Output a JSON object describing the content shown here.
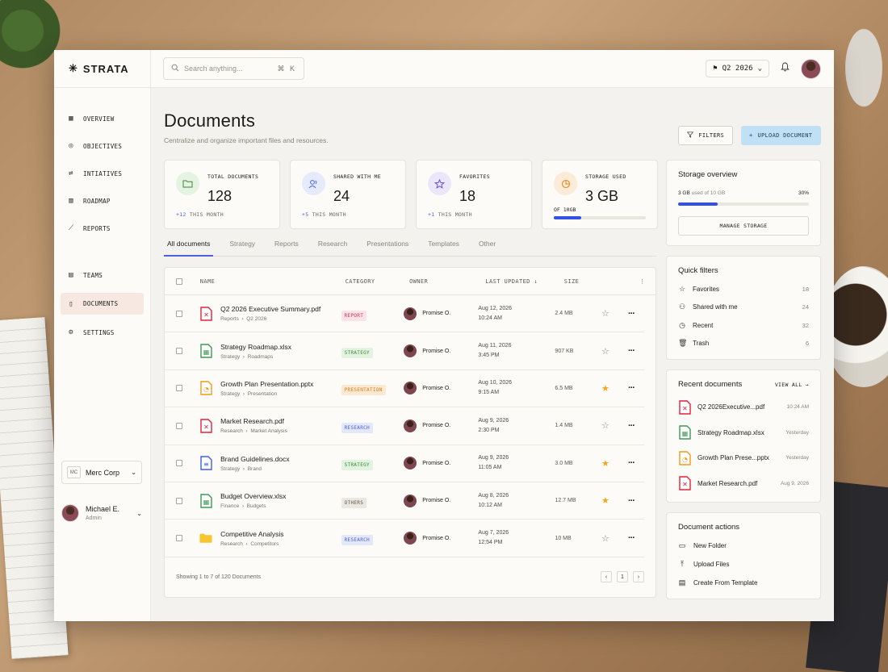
{
  "brand": {
    "name": "STRATA"
  },
  "search": {
    "placeholder": "Search anything...",
    "shortcut": "⌘ K"
  },
  "header": {
    "period": "Q2 2026"
  },
  "sidebar": {
    "items": [
      {
        "label": "OVERVIEW",
        "icon": "grid-icon"
      },
      {
        "label": "OBJECTIVES",
        "icon": "target-icon"
      },
      {
        "label": "INTIATIVES",
        "icon": "arrows-icon"
      },
      {
        "label": "ROADMAP",
        "icon": "map-icon"
      },
      {
        "label": "REPORTS",
        "icon": "chart-icon"
      }
    ],
    "items2": [
      {
        "label": "TEAMS",
        "icon": "team-icon"
      },
      {
        "label": "DOCUMENTS",
        "icon": "document-icon",
        "active": true
      },
      {
        "label": "SETTINGS",
        "icon": "gear-icon"
      }
    ],
    "org": {
      "initials": "MC",
      "name": "Merc Corp"
    },
    "user": {
      "name": "Michael E.",
      "role": "Admin"
    }
  },
  "page": {
    "title": "Documents",
    "subtitle": "Centralize and organize important files and resources.",
    "filters_label": "FILTERS",
    "upload_label": "UPLOAD DOCUMENT"
  },
  "stats": [
    {
      "label": "TOTAL DOCUMENTS",
      "value": "128",
      "delta": "+12",
      "delta_text": "THIS MONTH",
      "color": "#e4f3e2",
      "icon_color": "#3e8a3a"
    },
    {
      "label": "SHARED WITH ME",
      "value": "24",
      "delta": "+5",
      "delta_text": "THIS MONTH",
      "color": "#e6ebfb",
      "icon_color": "#4a62e0"
    },
    {
      "label": "FAVORITES",
      "value": "18",
      "delta": "+1",
      "delta_text": "THIS MONTH",
      "color": "#ece6fb",
      "icon_color": "#6a4fd8"
    },
    {
      "label": "STORAGE USED",
      "value": "3 GB",
      "of": "OF 10GB",
      "fraction": 0.3,
      "color": "#fcebd8",
      "icon_color": "#e58a1f"
    }
  ],
  "tabs": [
    "All documents",
    "Strategy",
    "Reports",
    "Research",
    "Presentations",
    "Templates",
    "Other"
  ],
  "table": {
    "headers": {
      "name": "NAME",
      "category": "CATEGORY",
      "owner": "OWNER",
      "updated": "LAST UPDATED ↓",
      "size": "SIZE"
    },
    "rows": [
      {
        "name": "Q2 2026 Executive Summary.pdf",
        "path1": "Reports",
        "path2": "Q2 2026",
        "type": "pdf",
        "category": "REPORT",
        "owner": "Promise O.",
        "date": "Aug 12, 2026",
        "time": "10:24 AM",
        "size": "2.4 MB",
        "fav": false
      },
      {
        "name": "Strategy Roadmap.xlsx",
        "path1": "Strategy",
        "path2": "Roadmaps",
        "type": "xlsx",
        "category": "STRATEGY",
        "owner": "Promise O.",
        "date": "Aug 11, 2026",
        "time": "3:45 PM",
        "size": "907 KB",
        "fav": false
      },
      {
        "name": "Growth Plan Presentation.pptx",
        "path1": "Strategy",
        "path2": "Presentation",
        "type": "pptx",
        "category": "PRESENTATION",
        "owner": "Promise O.",
        "date": "Aug 10, 2026",
        "time": "9:15 AM",
        "size": "6.5 MB",
        "fav": true
      },
      {
        "name": "Market Research.pdf",
        "path1": "Research",
        "path2": "Market Analysis",
        "type": "pdf",
        "category": "RESEARCH",
        "owner": "Promise O.",
        "date": "Aug 9, 2026",
        "time": "2:30 PM",
        "size": "1.4 MB",
        "fav": false
      },
      {
        "name": "Brand Guidelines.docx",
        "path1": "Strategy",
        "path2": "Brand",
        "type": "docx",
        "category": "STRATEGY",
        "owner": "Promise O.",
        "date": "Aug 9, 2026",
        "time": "11:05 AM",
        "size": "3.0 MB",
        "fav": true
      },
      {
        "name": "Budget Overview.xlsx",
        "path1": "Finance",
        "path2": "Budgets",
        "type": "xlsx",
        "category": "OTHERS",
        "owner": "Promise O.",
        "date": "Aug 8, 2026",
        "time": "10:12 AM",
        "size": "12.7 MB",
        "fav": true
      },
      {
        "name": "Competitive Analysis",
        "path1": "Research",
        "path2": "Competitors",
        "type": "folder",
        "category": "RESEARCH",
        "owner": "Promise O.",
        "date": "Aug 7, 2026",
        "time": "12:54 PM",
        "size": "10 MB",
        "fav": false
      }
    ],
    "footer": "Showing 1 to 7 of 120 Documents",
    "page": "1"
  },
  "categories": {
    "REPORT": {
      "bg": "#fde3e7",
      "fg": "#d1365a"
    },
    "STRATEGY": {
      "bg": "#e2f3df",
      "fg": "#3d8a3a"
    },
    "PRESENTATION": {
      "bg": "#fde9d2",
      "fg": "#d5801a"
    },
    "RESEARCH": {
      "bg": "#e4e8fb",
      "fg": "#4a62e0"
    },
    "OTHERS": {
      "bg": "#ebe8e3",
      "fg": "#5c574f"
    }
  },
  "storage_panel": {
    "title": "Storage overview",
    "used": "3 GB",
    "of": "used of 10 GB",
    "percent": "30%",
    "fraction": 0.3,
    "button": "MANAGE STORAGE"
  },
  "quick_filters": {
    "title": "Quick filters",
    "items": [
      {
        "label": "Favorites",
        "count": "18",
        "icon": "star-icon"
      },
      {
        "label": "Shared with me",
        "count": "24",
        "icon": "users-icon"
      },
      {
        "label": "Recent",
        "count": "32",
        "icon": "clock-icon"
      },
      {
        "label": "Trash",
        "count": "6",
        "icon": "trash-icon"
      }
    ]
  },
  "recent": {
    "title": "Recent documents",
    "view_all": "VIEW ALL",
    "items": [
      {
        "name": "Q2 2026Executive...pdf",
        "time": "10:24 AM",
        "type": "pdf"
      },
      {
        "name": "Strategy Roadmap.xlsx",
        "time": "Yesterday",
        "type": "xlsx"
      },
      {
        "name": "Growth Plan Prese...pptx",
        "time": "Yesterday",
        "type": "pptx"
      },
      {
        "name": "Market Research.pdf",
        "time": "Aug 9, 2026",
        "type": "pdf"
      }
    ]
  },
  "actions": {
    "title": "Document actions",
    "items": [
      {
        "label": "New Folder",
        "icon": "folder-icon"
      },
      {
        "label": "Upload Files",
        "icon": "upload-icon"
      },
      {
        "label": "Create From Template",
        "icon": "template-icon"
      }
    ]
  },
  "file_colors": {
    "pdf": "#e0233a",
    "xlsx": "#3f9a55",
    "pptx": "#f29a1d",
    "docx": "#3d5ee8",
    "folder": "#f7c531"
  }
}
